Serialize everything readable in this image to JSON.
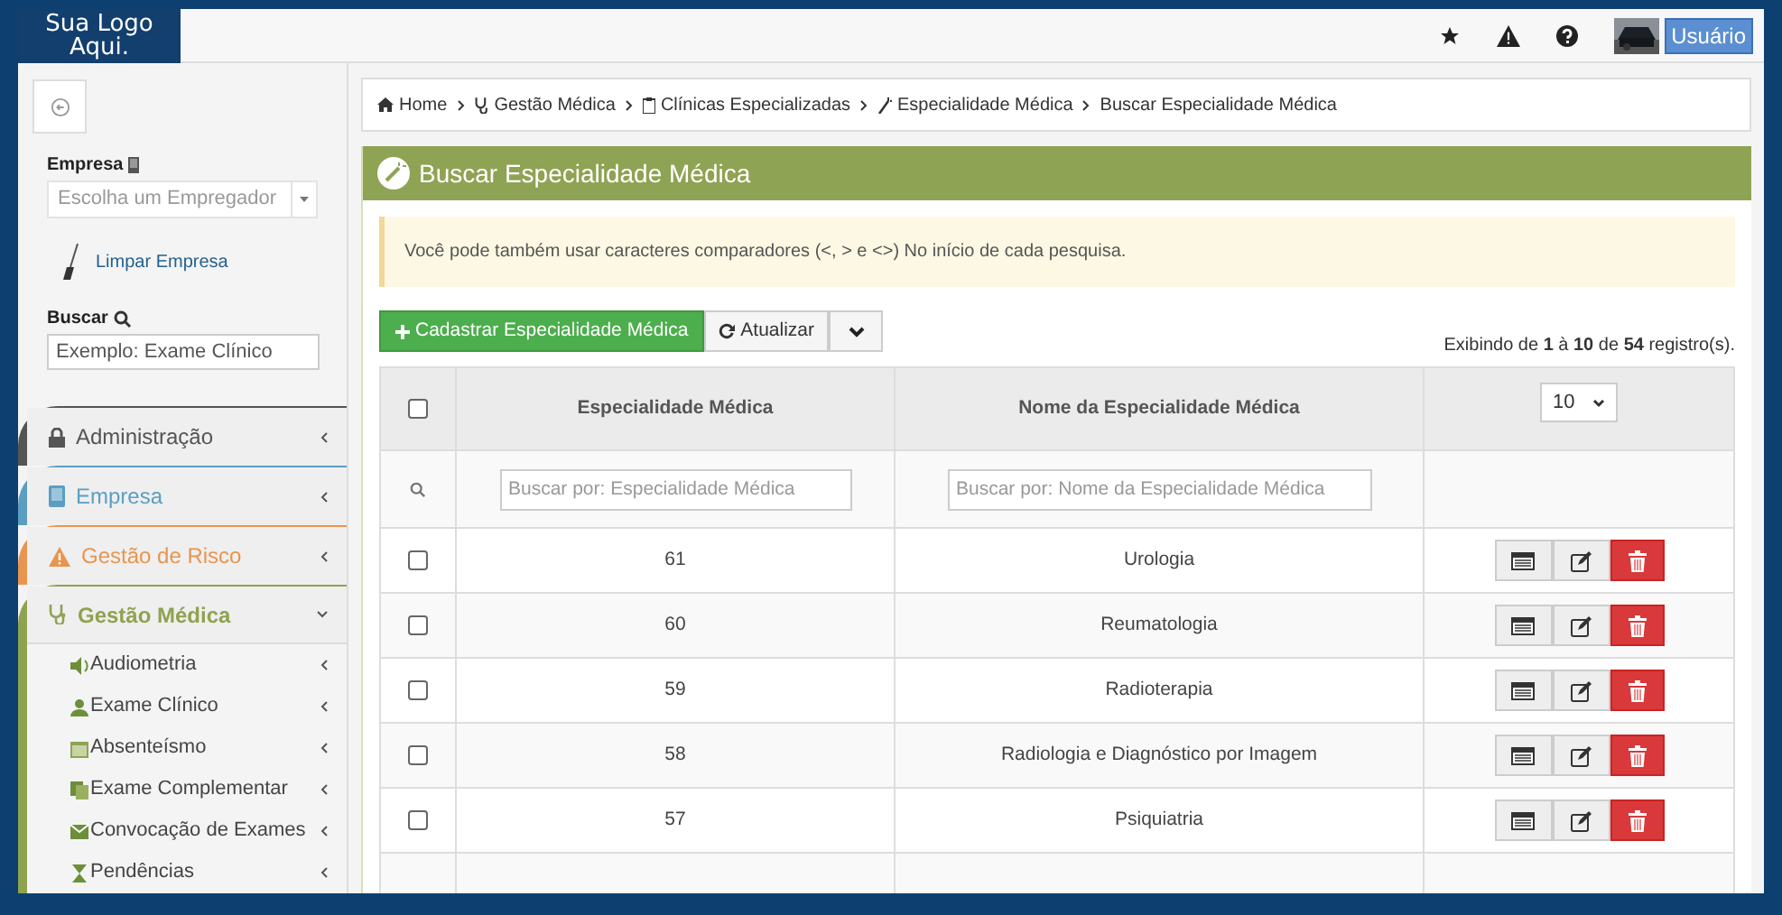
{
  "topbar": {
    "logo": "Sua Logo Aqui.",
    "user": "Usuário"
  },
  "sidebar": {
    "company_label": "Empresa",
    "company_placeholder": "Escolha um Empregador",
    "clear_link": "Limpar Empresa",
    "search_label": "Buscar",
    "search_placeholder": "Exemplo: Exame Clínico",
    "menus": [
      {
        "label": "Administração",
        "color": "#555555",
        "expanded": false
      },
      {
        "label": "Empresa",
        "color": "#5b9ec2",
        "expanded": false
      },
      {
        "label": "Gestão de Risco",
        "color": "#e8954f",
        "expanded": false
      },
      {
        "label": "Gestão Médica",
        "color": "#8fa34f",
        "expanded": true,
        "children": [
          {
            "label": "Audiometria"
          },
          {
            "label": "Exame Clínico"
          },
          {
            "label": "Absenteísmo"
          },
          {
            "label": "Exame Complementar"
          },
          {
            "label": "Convocação de Exames"
          },
          {
            "label": "Pendências"
          }
        ]
      }
    ]
  },
  "breadcrumb": [
    "Home",
    "Gestão Médica",
    "Clínicas Especializadas",
    "Especialidade Médica",
    "Buscar Especialidade Médica"
  ],
  "panel": {
    "title": "Buscar Especialidade Médica",
    "alert": "Você pode também usar caracteres comparadores (<, > e <>) No início de cada pesquisa.",
    "buttons": [
      "Cadastrar Especialidade Médica",
      "Atualizar"
    ],
    "records": "Exibindo de **1** à **10** de **54** registro(s)."
  },
  "table": {
    "columns": [
      "Especialidade Médica",
      "Nome da Especialidade Médica"
    ],
    "page_size": "10",
    "all_checked": false,
    "filters": [
      {
        "placeholder": "Buscar por: Especialidade Médica"
      },
      {
        "placeholder": "Buscar por: Nome da Especialidade Médica"
      }
    ],
    "rows": [
      {
        "code": "61",
        "name": "Urologia",
        "checked": false
      },
      {
        "code": "60",
        "name": "Reumatologia",
        "checked": false
      },
      {
        "code": "59",
        "name": "Radioterapia",
        "checked": false
      },
      {
        "code": "58",
        "name": "Radiologia e Diagnóstico por Imagem",
        "checked": false
      },
      {
        "code": "57",
        "name": "Psiquiatria",
        "checked": false
      }
    ]
  }
}
